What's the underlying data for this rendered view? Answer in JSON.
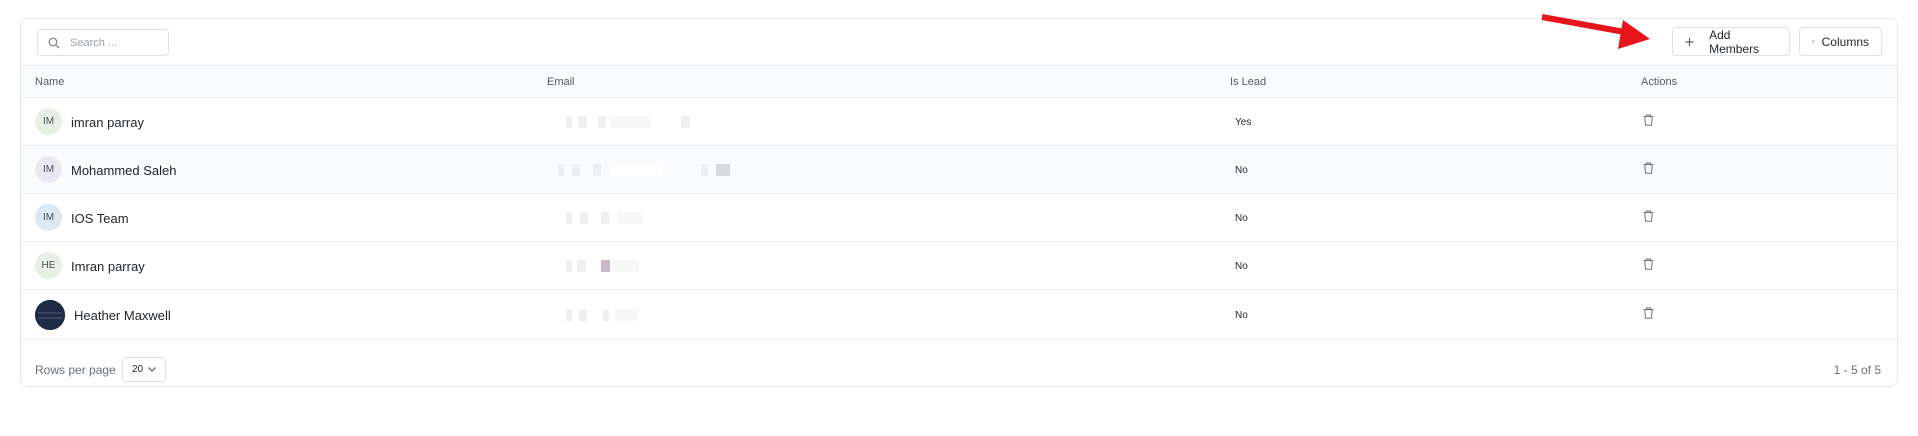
{
  "toolbar": {
    "search_placeholder": "Search ...",
    "add_members_label": "Add Members",
    "columns_label": "Columns"
  },
  "table": {
    "headers": {
      "name": "Name",
      "email": "Email",
      "is_lead": "Is Lead",
      "actions": "Actions"
    },
    "rows": [
      {
        "initials": "IM",
        "name": "imran parray",
        "is_lead": "Yes",
        "avatar_bg": "#e8efe4"
      },
      {
        "initials": "IM",
        "name": "Mohammed Saleh",
        "is_lead": "No",
        "avatar_bg": "#ece8f3"
      },
      {
        "initials": "IM",
        "name": "IOS Team",
        "is_lead": "No",
        "avatar_bg": "#dde8f1"
      },
      {
        "initials": "HE",
        "name": "Imran parray",
        "is_lead": "No",
        "avatar_bg": "#e8efe4"
      },
      {
        "initials": "",
        "name": "Heather Maxwell",
        "is_lead": "No",
        "avatar_bg": "#1f2a44"
      }
    ]
  },
  "footer": {
    "rows_per_page_label": "Rows per page",
    "rows_per_page_value": "20",
    "range_text": "1 - 5 of 5"
  },
  "colors": {
    "annotation_arrow": "#e8141b",
    "border": "#e4e7ea"
  },
  "icons": [
    "search-icon",
    "plus-icon",
    "columns-icon",
    "trash-icon",
    "chevron-down-icon"
  ]
}
